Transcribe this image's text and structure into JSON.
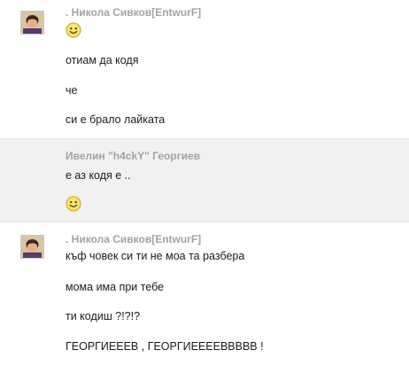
{
  "messages": [
    {
      "sender": ". Никола Сивков[EntwurF]",
      "lines": [
        "отиам да кодя",
        "че",
        "си е брало лайката"
      ],
      "has_avatar": true,
      "leading_icon": "smiley-icon"
    },
    {
      "sender": "Ивелин \"h4ckY\" Георгиев",
      "lines": [
        "е аз кодя е .."
      ],
      "has_avatar": false,
      "trailing_icon": "smiley-icon"
    },
    {
      "sender": ". Никола Сивков[EntwurF]",
      "lines": [
        "къф човек си ти не моа та разбера",
        "мома има при тебе",
        "ти кодиш ?!?!?",
        "ГЕОРГИЕЕЕВ , ГЕОРГИЕЕЕЕВВВВВ !"
      ],
      "has_avatar": true
    }
  ],
  "colors": {
    "sender": "#a3a3a3",
    "text": "#1a1a1a",
    "alt_background": "#f1f1f1"
  }
}
